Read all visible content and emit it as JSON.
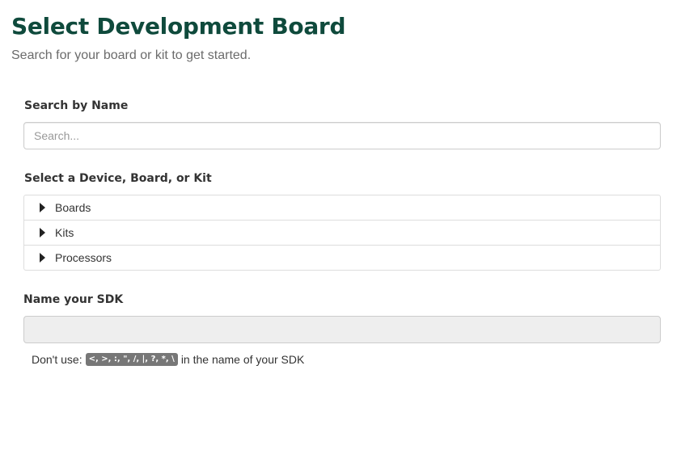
{
  "header": {
    "title": "Select Development Board",
    "subtitle": "Search for your board or kit to get started."
  },
  "search": {
    "label": "Search by Name",
    "placeholder": "Search...",
    "value": ""
  },
  "device_selector": {
    "label": "Select a Device, Board, or Kit",
    "items": [
      {
        "label": "Boards",
        "icon": "caret-right-icon",
        "expanded": false
      },
      {
        "label": "Kits",
        "icon": "caret-right-icon",
        "expanded": false
      },
      {
        "label": "Processors",
        "icon": "caret-right-icon",
        "expanded": false
      }
    ]
  },
  "sdk_name": {
    "label": "Name your SDK",
    "value": "",
    "help_prefix": "Don't use:",
    "forbidden_chars": "<, >, :, \", /, |, ?, *, \\",
    "help_suffix": "in the name of your SDK"
  },
  "colors": {
    "title": "#0f4a3c",
    "subtitle": "#6b6b6b",
    "badge_bg": "#777777",
    "disabled_input_bg": "#eeeeee"
  }
}
